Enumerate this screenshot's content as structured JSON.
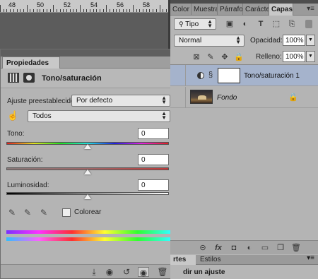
{
  "ruler": {
    "numbers": [
      "48",
      "50",
      "52",
      "54",
      "56",
      "58"
    ]
  },
  "properties": {
    "tab_label": "Propiedades",
    "collapse_glyph": "◂◂",
    "menu_glyph": "▾≡",
    "adjustment_title": "Tono/saturación",
    "preset_label": "Ajuste preestablecido:",
    "preset_value": "Por defecto",
    "channel_value": "Todos",
    "hue_label": "Tono:",
    "hue_value": "0",
    "hue_level": 0.5,
    "saturation_label": "Saturación:",
    "saturation_value": "0",
    "saturation_level": 0.5,
    "lightness_label": "Luminosidad:",
    "lightness_value": "0",
    "lightness_level": 0.5,
    "colorize_label": "Colorear",
    "colorize_checked": false
  },
  "layers_panel": {
    "tabs": [
      "Color",
      "Muestra",
      "Párrafo",
      "Carácter",
      "Capas"
    ],
    "active_tab": "Capas",
    "menu_glyph": "▾≡",
    "filter_value": "Tipo",
    "blend_mode": "Normal",
    "opacity_label": "Opacidad:",
    "opacity_value": "100%",
    "fill_label": "Relleno:",
    "fill_value": "100%",
    "layers": [
      {
        "name": "Tono/saturación 1",
        "selected": true
      },
      {
        "name": "Fondo",
        "selected": false
      }
    ]
  },
  "bottom_panel": {
    "tabs": [
      "rtes",
      "Estilos"
    ],
    "history_item": "dir un ajuste"
  },
  "colors": {
    "panel_bg": "#b4b4b4",
    "selected_layer": "#a5b3cc",
    "canvas_bg": "#5c5c5c"
  }
}
